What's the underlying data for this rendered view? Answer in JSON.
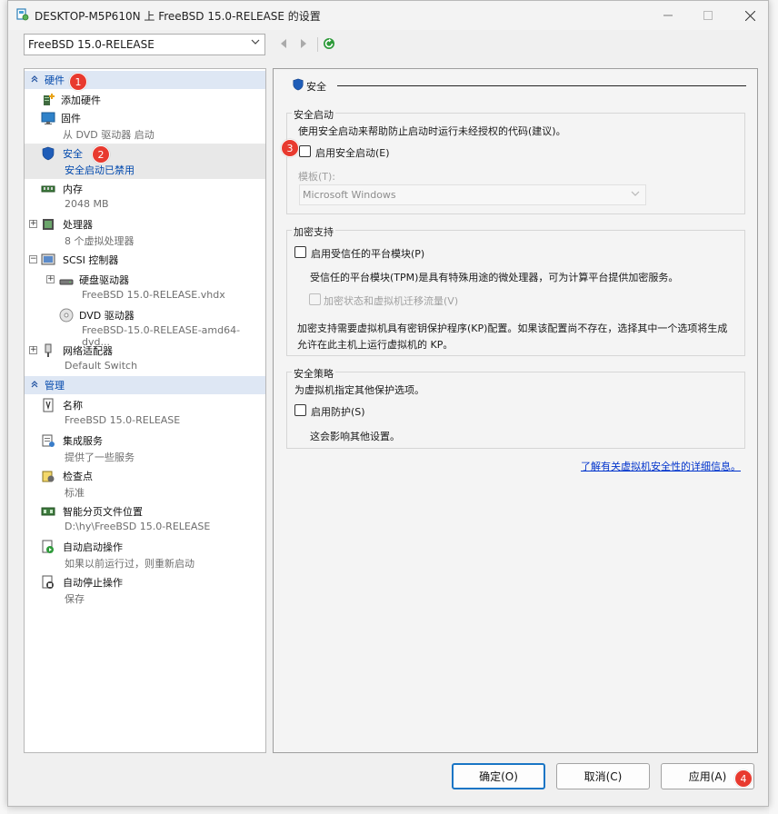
{
  "window": {
    "title": "DESKTOP-M5P610N 上 FreeBSD 15.0-RELEASE 的设置",
    "vm_select_value": "FreeBSD 15.0-RELEASE"
  },
  "tree": {
    "hardware_header": "硬件",
    "management_header": "管理",
    "hardware_items": [
      {
        "name": "添加硬件",
        "sub": ""
      },
      {
        "name": "固件",
        "sub": "从 DVD 驱动器 启动"
      },
      {
        "name": "安全",
        "sub": "安全启动已禁用"
      },
      {
        "name": "内存",
        "sub": "2048 MB"
      },
      {
        "name": "处理器",
        "sub": "8 个虚拟处理器"
      },
      {
        "name": "SCSI 控制器",
        "sub": ""
      },
      {
        "name": "硬盘驱动器",
        "sub": "FreeBSD 15.0-RELEASE.vhdx"
      },
      {
        "name": "DVD 驱动器",
        "sub": "FreeBSD-15.0-RELEASE-amd64-dvd..."
      },
      {
        "name": "网络适配器",
        "sub": "Default Switch"
      }
    ],
    "management_items": [
      {
        "name": "名称",
        "sub": "FreeBSD 15.0-RELEASE"
      },
      {
        "name": "集成服务",
        "sub": "提供了一些服务"
      },
      {
        "name": "检查点",
        "sub": "标准"
      },
      {
        "name": "智能分页文件位置",
        "sub": "D:\\hy\\FreeBSD 15.0-RELEASE"
      },
      {
        "name": "自动启动操作",
        "sub": "如果以前运行过，则重新启动"
      },
      {
        "name": "自动停止操作",
        "sub": "保存"
      }
    ]
  },
  "panel": {
    "heading": "安全",
    "secure_boot": {
      "title": "安全启动",
      "desc": "使用安全启动来帮助防止启动时运行未经授权的代码(建议)。",
      "checkbox_label": "启用安全启动(E)",
      "checked": false,
      "template_label": "模板(T):",
      "template_value": "Microsoft Windows"
    },
    "encryption": {
      "title": "加密支持",
      "tpm_label": "启用受信任的平台模块(P)",
      "tpm_desc": "受信任的平台模块(TPM)是具有特殊用途的微处理器，可为计算平台提供加密服务。",
      "encrypt_label": "加密状态和虚拟机迁移流量(V)",
      "kp_line1": "加密支持需要虚拟机具有密钥保护程序(KP)配置。如果该配置尚不存在，选择其中一个选项将生成",
      "kp_line2": "允许在此主机上运行虚拟机的 KP。"
    },
    "policy": {
      "title": "安全策略",
      "desc": "为虚拟机指定其他保护选项。",
      "shield_label": "启用防护(S)",
      "note": "这会影响其他设置。"
    },
    "learn_more": "了解有关虚拟机安全性的详细信息。"
  },
  "buttons": {
    "ok": "确定(O)",
    "cancel": "取消(C)",
    "apply": "应用(A)"
  },
  "badges": [
    "1",
    "2",
    "3",
    "4"
  ],
  "colors": {
    "accent": "#0047ab",
    "badge": "#e83a2f",
    "selection": "#e8e8e8",
    "section_header": "#dee7f4"
  },
  "icons": {
    "title": "hyperv-settings-icon",
    "security": "shield-icon"
  }
}
